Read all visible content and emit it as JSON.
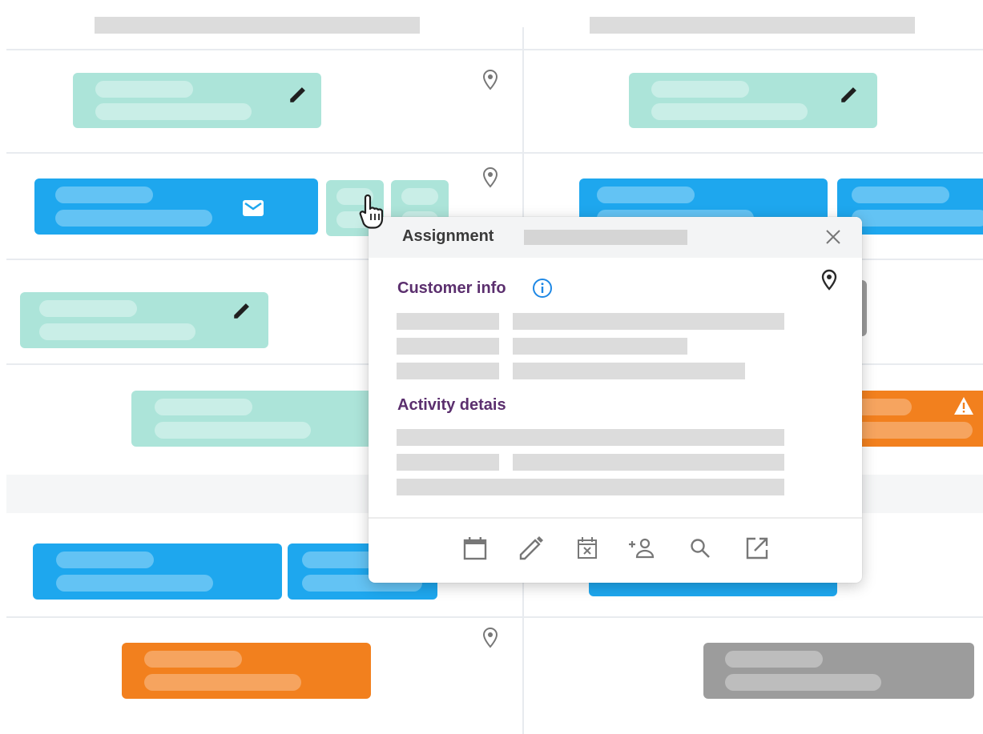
{
  "popup": {
    "title": "Assignment",
    "sections": {
      "customer_info": "Customer info",
      "activity_details": "Activity detais"
    },
    "toolbar": {
      "icons": [
        "calendar-icon",
        "edit-icon",
        "cancel-date-icon",
        "add-person-icon",
        "search-icon",
        "open-external-icon"
      ]
    }
  },
  "schedule": {
    "columns": 2,
    "colors": {
      "green": "#ace4d9",
      "blue": "#1ea7ee",
      "orange": "#f2801e",
      "gray": "#9c9c9c",
      "section_title": "#5b2f6e",
      "info_blue": "#1e88e5"
    }
  }
}
